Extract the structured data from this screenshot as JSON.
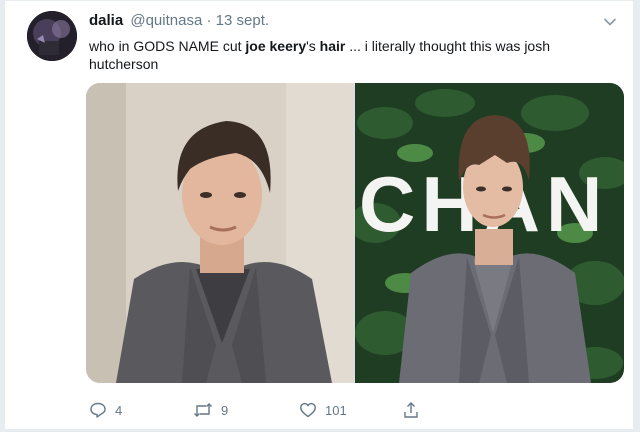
{
  "tweet": {
    "display_name": "dalia",
    "handle": "@quitnasa",
    "separator": "·",
    "date": "13 sept.",
    "text_part1": "who in GODS NAME cut ",
    "text_bold1": "joe keery",
    "text_part2": "'s ",
    "text_bold2": "hair",
    "text_part3": " ... i literally thought this was josh hutcherson"
  },
  "media": {
    "right_backdrop_letters": "CHAN"
  },
  "actions": {
    "reply_count": "4",
    "retweet_count": "9",
    "like_count": "101"
  },
  "icons": {
    "reply": "reply-icon",
    "retweet": "retweet-icon",
    "like": "heart-icon",
    "share": "share-icon",
    "caret": "chevron-down-icon"
  },
  "colors": {
    "secondary_text": "#657786",
    "primary_text": "#14171a"
  }
}
